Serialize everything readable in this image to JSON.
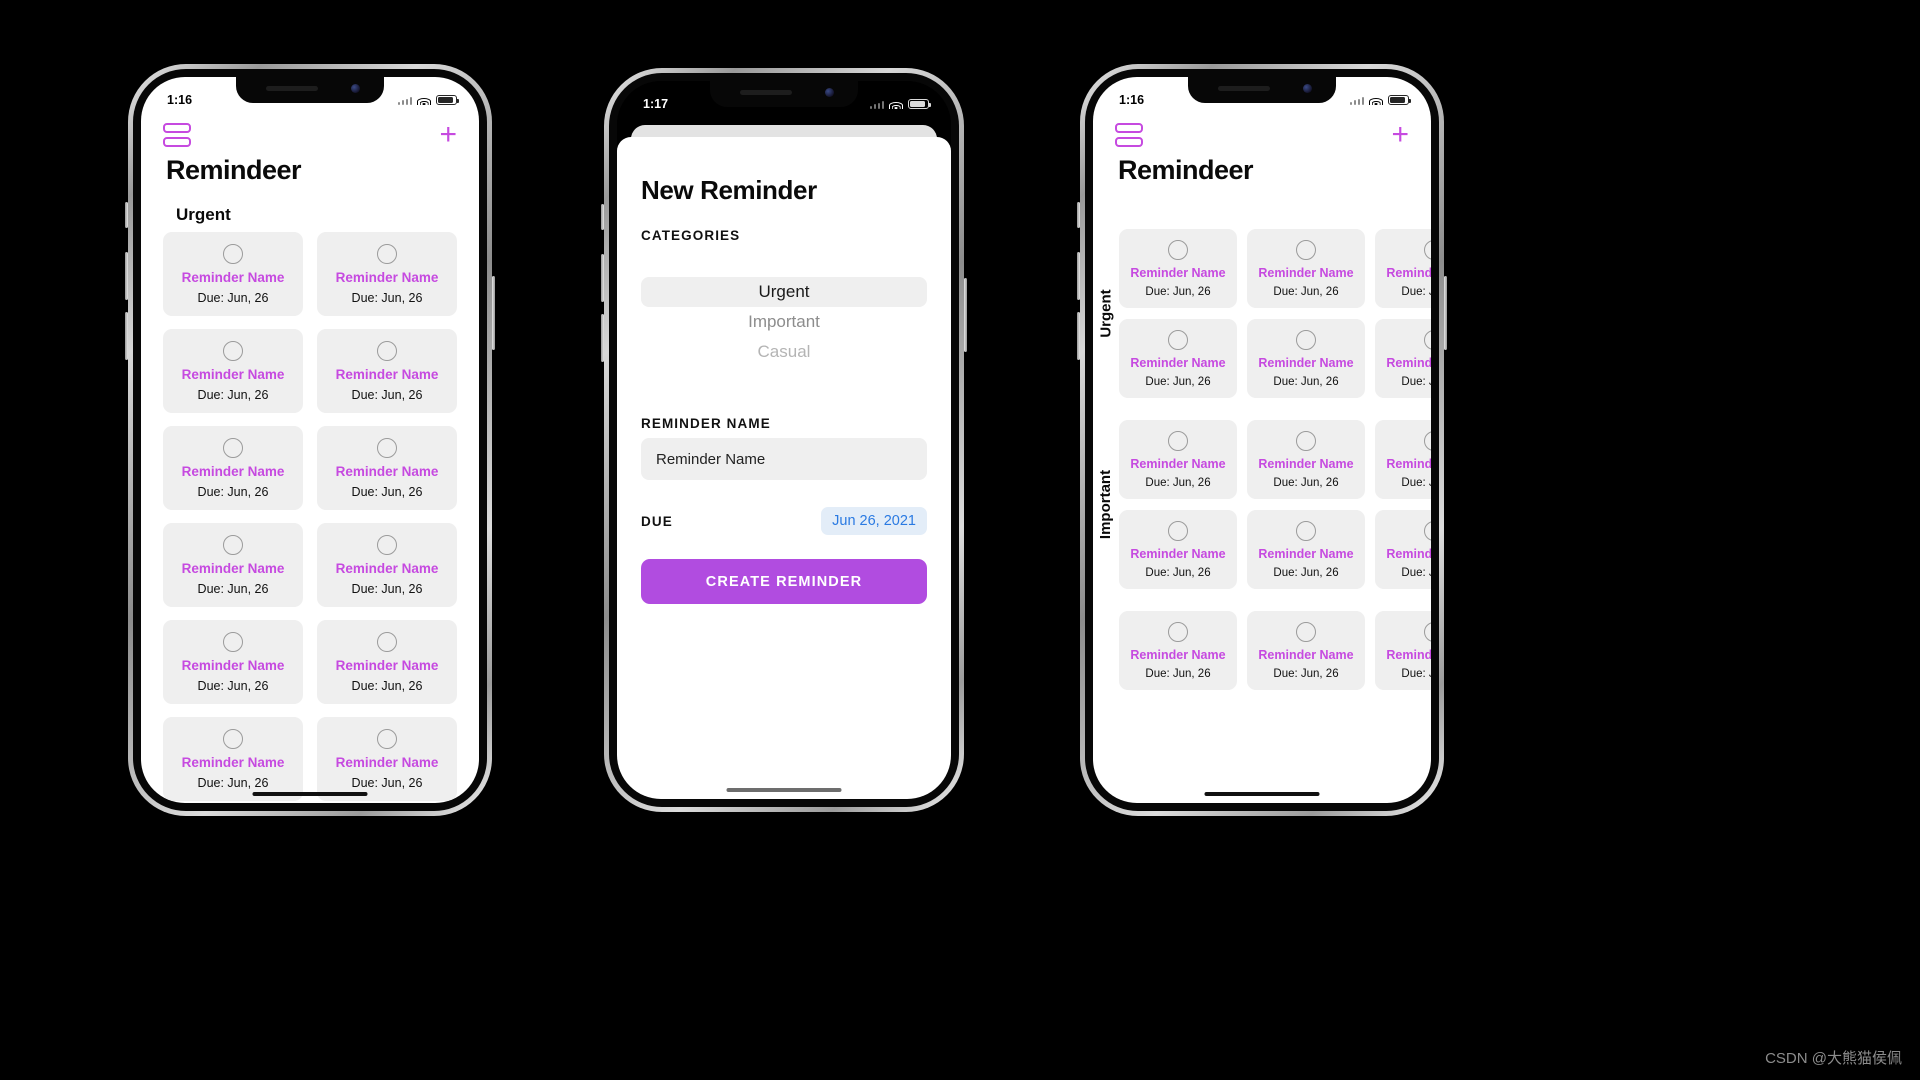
{
  "watermark": "CSDN @大熊猫侯佩",
  "phone1": {
    "status": {
      "time": "1:16"
    },
    "appbar": {
      "menu_icon": "hamburger-icon",
      "add_icon": "plus-icon"
    },
    "title": "Remindeer",
    "section": "Urgent",
    "card": {
      "name": "Reminder Name",
      "due": "Due: Jun, 26",
      "checkbox_icon": "circle-outline-icon"
    },
    "card_count": 12
  },
  "phone2": {
    "status": {
      "time": "1:17"
    },
    "heading": "New Reminder",
    "categories_label": "CATEGORIES",
    "categories": [
      {
        "label": "Urgent",
        "selected": true
      },
      {
        "label": "Important",
        "selected": false
      },
      {
        "label": "Casual",
        "selected": false
      }
    ],
    "name_label": "REMINDER NAME",
    "name_value": "Reminder Name",
    "name_placeholder": "Reminder Name",
    "due_label": "DUE",
    "due_value": "Jun 26, 2021",
    "cta_label": "CREATE REMINDER",
    "accent": "#b14ce0",
    "date_color": "#2a7ae2"
  },
  "phone3": {
    "status": {
      "time": "1:16"
    },
    "appbar": {
      "menu_icon": "hamburger-icon",
      "add_icon": "plus-icon"
    },
    "title": "Remindeer",
    "card": {
      "name": "Reminder Name",
      "due": "Due: Jun, 26",
      "checkbox_icon": "circle-outline-icon"
    },
    "sections": [
      {
        "label": "Urgent",
        "rows": 2,
        "cols": 3
      },
      {
        "label": "Important",
        "rows": 2,
        "cols": 3
      },
      {
        "label": "",
        "rows": 1,
        "cols": 3
      }
    ]
  },
  "colors": {
    "accent_purple": "#c64ae0",
    "card_bg": "#efefef",
    "button_purple": "#b14ce0",
    "date_blue": "#2a7ae2"
  }
}
